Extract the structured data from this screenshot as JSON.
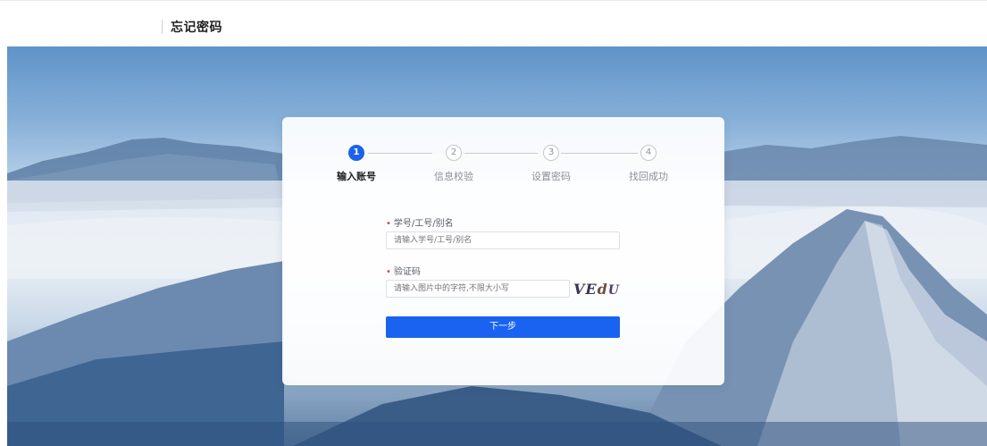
{
  "header": {
    "title": "忘记密码"
  },
  "steps": [
    {
      "number": "1",
      "label": "输入账号",
      "active": true
    },
    {
      "number": "2",
      "label": "信息校验",
      "active": false
    },
    {
      "number": "3",
      "label": "设置密码",
      "active": false
    },
    {
      "number": "4",
      "label": "找回成功",
      "active": false
    }
  ],
  "form": {
    "account": {
      "required_mark": "•",
      "label": "学号/工号/别名",
      "placeholder": "请输入学号/工号/别名"
    },
    "captcha": {
      "required_mark": "•",
      "label": "验证码",
      "placeholder": "请输入图片中的字符,不限大小写",
      "image_text": [
        "VE",
        "d",
        "U"
      ]
    },
    "next_button": "下一步"
  },
  "colors": {
    "primary": "#1a63f0",
    "required": "#e33d3d"
  }
}
